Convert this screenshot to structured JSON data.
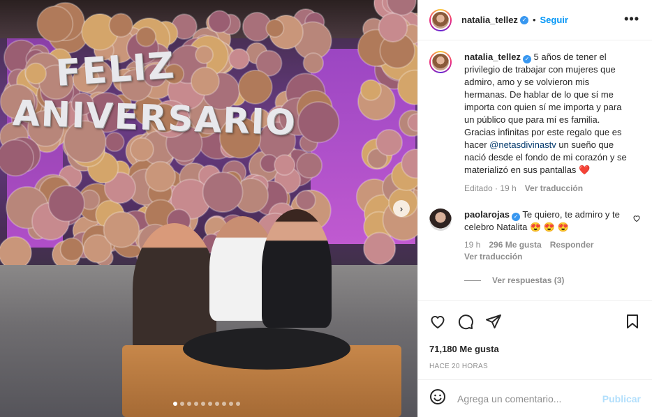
{
  "post": {
    "banner_line1": "FELIZ",
    "banner_line2": "ANIVERSARIO",
    "carousel_count": 10,
    "carousel_active": 0
  },
  "header": {
    "username": "natalia_tellez",
    "separator": "•",
    "follow_label": "Seguir",
    "more_label": "•••"
  },
  "caption": {
    "username": "natalia_tellez",
    "text_before": " 5 años de tener el privilegio de trabajar con mujeres que admiro, amo y se volvieron mis hermanas. De hablar de lo que sí me importa con quien sí me importa y para un público que para mí es familia. Gracias infinitas por este regalo que es hacer ",
    "mention": "@netasdivinastv",
    "text_after": " un sueño que nació desde el fondo de mi corazón y se materializó en sus pantallas ",
    "heart": "❤️",
    "edited": "Editado · 19 h",
    "translate": "Ver traducción"
  },
  "comment": {
    "username": "paolarojas",
    "text": " Te quiero, te admiro y te celebro Natalita ",
    "emojis": "😍 😍 😍",
    "time": "19 h",
    "likes": "296 Me gusta",
    "reply": "Responder",
    "translate": "Ver traducción",
    "view_replies": "Ver respuestas (3)"
  },
  "actions": {
    "likes": "71,180 Me gusta",
    "time": "HACE 20 HORAS"
  },
  "add_comment": {
    "placeholder": "Agrega un comentario...",
    "post_label": "Publicar"
  }
}
